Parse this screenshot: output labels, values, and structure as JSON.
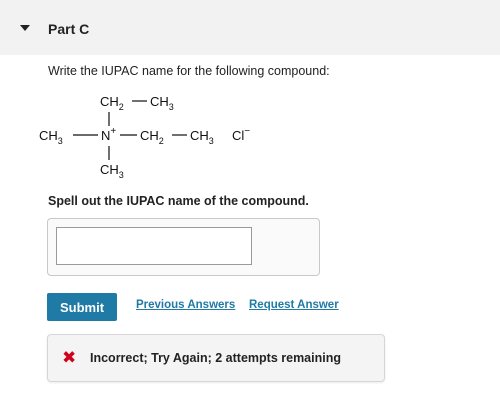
{
  "part": {
    "title": "Part C"
  },
  "question": {
    "prompt": "Write the IUPAC name for the following compound:",
    "instruction": "Spell out the IUPAC name of the compound."
  },
  "formula": {
    "top_ch2": "CH",
    "top_ch2_sub": "2",
    "top_ch3": "CH",
    "top_ch3_sub": "3",
    "left_ch3": "CH",
    "left_ch3_sub": "3",
    "nitrogen": "N",
    "nitrogen_charge": "+",
    "right_ch2": "CH",
    "right_ch2_sub": "2",
    "right_ch3": "CH",
    "right_ch3_sub": "3",
    "counter_ion": "Cl",
    "counter_ion_charge": "−",
    "bottom_ch3": "CH",
    "bottom_ch3_sub": "3"
  },
  "answer": {
    "value": "",
    "placeholder": ""
  },
  "actions": {
    "submit_label": "Submit",
    "previous_answers_label": "Previous Answers",
    "request_answer_label": "Request Answer"
  },
  "feedback": {
    "icon": "x-mark-icon",
    "text": "Incorrect; Try Again; 2 attempts remaining",
    "color": "#d0021b"
  },
  "colors": {
    "accent": "#1f7aa6",
    "header_bg": "#f2f2f2"
  }
}
